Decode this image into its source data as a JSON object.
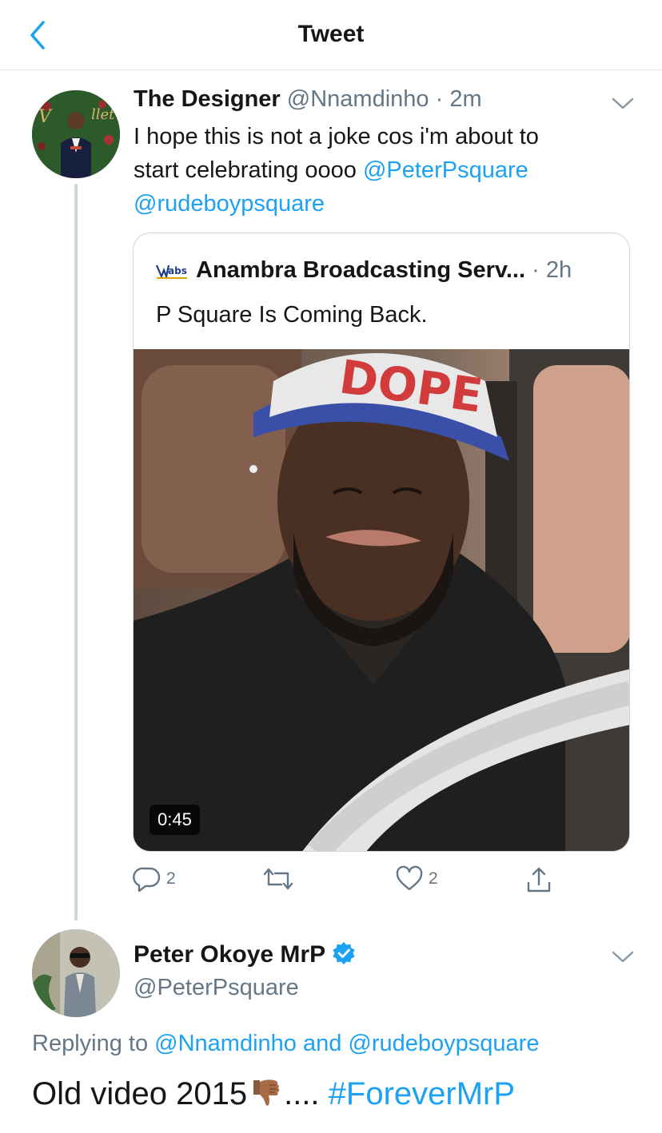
{
  "header": {
    "title": "Tweet",
    "back_icon": "back-chevron-icon"
  },
  "tweet": {
    "author_name": "The Designer",
    "author_handle": "@Nnamdinho",
    "time": "· 2m",
    "text_line1": "I hope this is not a joke cos i'm about to",
    "text_line2_prefix": "start celebrating oooo ",
    "mention1": "@PeterPsquare",
    "mention2": "@rudeboypsquare",
    "quote": {
      "author": "Anambra Broadcasting Serv...",
      "time": "· 2h",
      "logo_text": "abs",
      "text": "P Square Is Coming Back.",
      "video_duration": "0:45"
    },
    "actions": {
      "replies": "2",
      "likes": "2"
    }
  },
  "reply": {
    "author_name": "Peter Okoye MrP",
    "author_handle": "@PeterPsquare",
    "replying_label": "Replying to ",
    "replying_user1": "@Nnamdinho",
    "replying_and": " and ",
    "replying_user2": "@rudeboypsquare",
    "text_prefix": "Old video 2015",
    "text_suffix": ".... ",
    "hashtag": "#ForeverMrP",
    "emoji": "thumbs-down-emoji"
  },
  "colors": {
    "link": "#1da1f2",
    "muted": "#657786",
    "text": "#14171a",
    "border": "#e1e8ed"
  }
}
